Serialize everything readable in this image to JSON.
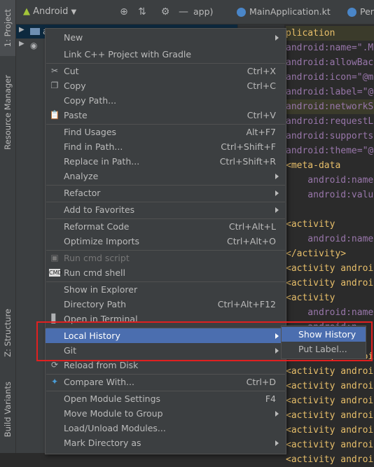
{
  "left_strip": {
    "project_tab": "1: Project",
    "resource_tab": "Resource Manager",
    "structure_tab": "Z: Structure",
    "build_tab": "Build Variants"
  },
  "project_panel": {
    "view_selector": "Android",
    "tree_app": "app"
  },
  "editor": {
    "tabs": [
      {
        "label": "app)"
      },
      {
        "label": "MainApplication.kt"
      },
      {
        "label": "Per"
      }
    ],
    "code_lines": [
      {
        "t": "plication",
        "cls": "tag"
      },
      {
        "t": "android:name=\".M",
        "cls": "attr"
      },
      {
        "t": "android:allowBac",
        "cls": "attr"
      },
      {
        "t": "android:icon=\"@m",
        "cls": "attr"
      },
      {
        "t": "android:label=\"@",
        "cls": "attr"
      },
      {
        "t": "android:networkS",
        "cls": "attr"
      },
      {
        "t": "android:requestL",
        "cls": "attr"
      },
      {
        "t": "android:supports",
        "cls": "attr"
      },
      {
        "t": "android:theme=\"@",
        "cls": "attr"
      },
      {
        "t": "<meta-data",
        "cls": "tag"
      },
      {
        "t": "    android:name",
        "cls": "attr"
      },
      {
        "t": "    android:valu",
        "cls": "attr"
      },
      {
        "t": "",
        "cls": "attr"
      },
      {
        "t": "<activity",
        "cls": "tag"
      },
      {
        "t": "    android:name",
        "cls": "attr"
      },
      {
        "t": "</activity>",
        "cls": "tag"
      },
      {
        "t": "<activity androi",
        "cls": "tag"
      },
      {
        "t": "<activity androi",
        "cls": "tag"
      },
      {
        "t": "<activity",
        "cls": "tag"
      },
      {
        "t": "    android:name",
        "cls": "attr"
      },
      {
        "t": "    android:n",
        "cls": "attr"
      },
      {
        "t": "",
        "cls": "attr"
      },
      {
        "t": "<activity androi",
        "cls": "tag"
      },
      {
        "t": "<activity androi",
        "cls": "tag"
      },
      {
        "t": "<activity androi",
        "cls": "tag"
      },
      {
        "t": "<activity androi",
        "cls": "tag"
      },
      {
        "t": "<activity androi",
        "cls": "tag"
      },
      {
        "t": "<activity androi",
        "cls": "tag"
      },
      {
        "t": "<activity androi",
        "cls": "tag"
      },
      {
        "t": "<activity androi",
        "cls": "tag"
      }
    ]
  },
  "menu": {
    "new": "New",
    "link_cpp": "Link C++ Project with Gradle",
    "cut": "Cut",
    "cut_sc": "Ctrl+X",
    "copy": "Copy",
    "copy_sc": "Ctrl+C",
    "copy_path": "Copy Path...",
    "paste": "Paste",
    "paste_sc": "Ctrl+V",
    "find_usages": "Find Usages",
    "find_usages_sc": "Alt+F7",
    "find_in_path": "Find in Path...",
    "find_in_path_sc": "Ctrl+Shift+F",
    "replace_in_path": "Replace in Path...",
    "replace_in_path_sc": "Ctrl+Shift+R",
    "analyze": "Analyze",
    "refactor": "Refactor",
    "add_to_favorites": "Add to Favorites",
    "reformat_code": "Reformat Code",
    "reformat_code_sc": "Ctrl+Alt+L",
    "optimize_imports": "Optimize Imports",
    "optimize_imports_sc": "Ctrl+Alt+O",
    "run_cmd_script": "Run cmd script",
    "run_cmd_shell": "Run cmd shell",
    "show_in_explorer": "Show in Explorer",
    "directory_path": "Directory Path",
    "directory_path_sc": "Ctrl+Alt+F12",
    "open_in_terminal": "Open in Terminal",
    "local_history": "Local History",
    "git": "Git",
    "reload_from_disk": "Reload from Disk",
    "compare_with": "Compare With...",
    "compare_with_sc": "Ctrl+D",
    "open_module_settings": "Open Module Settings",
    "open_module_settings_sc": "F4",
    "move_module_to_group": "Move Module to Group",
    "load_unload_modules": "Load/Unload Modules...",
    "mark_directory_as": "Mark Directory as"
  },
  "submenu": {
    "show_history": "Show History",
    "put_label": "Put Label..."
  }
}
